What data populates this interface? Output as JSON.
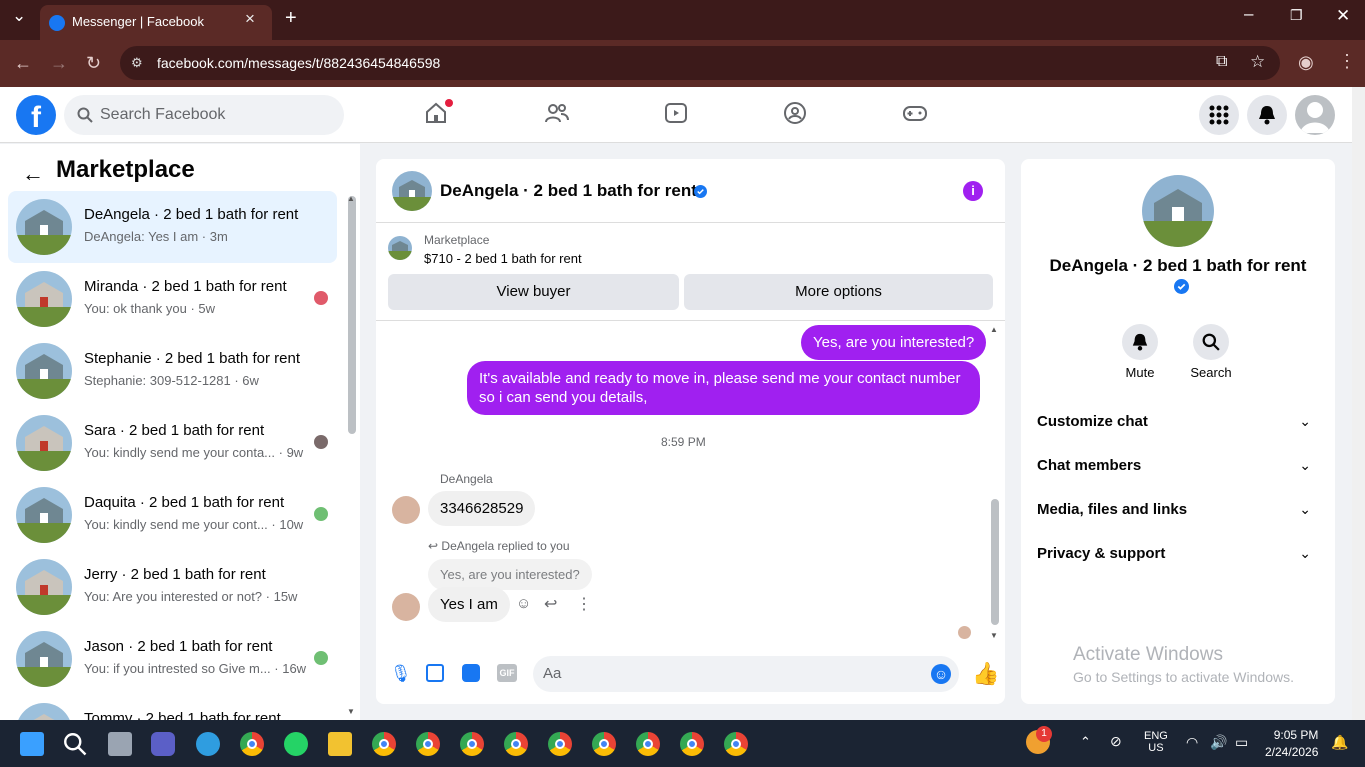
{
  "browser": {
    "tab_title": "Messenger | Facebook",
    "url": "facebook.com/messages/t/882436454846598"
  },
  "header": {
    "search_placeholder": "Search Facebook"
  },
  "sidebar": {
    "title": "Marketplace",
    "conversations": [
      {
        "name": "DeAngela · 2 bed 1 bath for rent",
        "preview": "DeAngela: Yes I am · 3m",
        "active": true
      },
      {
        "name": "Miranda · 2 bed 1 bath for rent",
        "preview": "You: ok thank you · 5w"
      },
      {
        "name": "Stephanie · 2 bed 1 bath for rent",
        "preview": "Stephanie: 309-512-1281 · 6w"
      },
      {
        "name": "Sara · 2 bed 1 bath for rent",
        "preview": "You: kindly send me your conta... · 9w"
      },
      {
        "name": "Daquita · 2 bed 1 bath for rent",
        "preview": "You: kindly send me your cont... · 10w"
      },
      {
        "name": "Jerry · 2 bed 1 bath for rent",
        "preview": "You: Are you interested or not? · 15w"
      },
      {
        "name": "Jason · 2 bed 1 bath for rent",
        "preview": "You: if you intrested so Give m... · 16w"
      },
      {
        "name": "Tommy · 2 bed 1 bath for rent",
        "preview": ""
      }
    ]
  },
  "chat": {
    "title": "DeAngela · 2 bed 1 bath for rent",
    "listing_source": "Marketplace",
    "listing": "$710 - 2 bed 1 bath for rent",
    "view_buyer": "View buyer",
    "more_options": "More options",
    "messages": {
      "out1": "Yes, are you interested?",
      "out2": "It's available and ready to move in, please send me your contact number so i can send you details,",
      "time": "8:59 PM",
      "sender": "DeAngela",
      "in1": "3346628529",
      "reply_note": "DeAngela replied to you",
      "quoted": "Yes, are you interested?",
      "in2": "Yes I am"
    },
    "input_placeholder": "Aa"
  },
  "details": {
    "name": "DeAngela · 2 bed 1 bath for rent",
    "mute": "Mute",
    "search": "Search",
    "sections": [
      "Customize chat",
      "Chat members",
      "Media, files and links",
      "Privacy & support"
    ],
    "watermark_title": "Activate Windows",
    "watermark_sub": "Go to Settings to activate Windows."
  },
  "taskbar": {
    "lang1": "ENG",
    "lang2": "US",
    "time": "9:05 PM",
    "date": "2/24/2026",
    "badge": "1"
  },
  "colors": {
    "accent": "#a020f0",
    "fb_blue": "#1877f2"
  }
}
